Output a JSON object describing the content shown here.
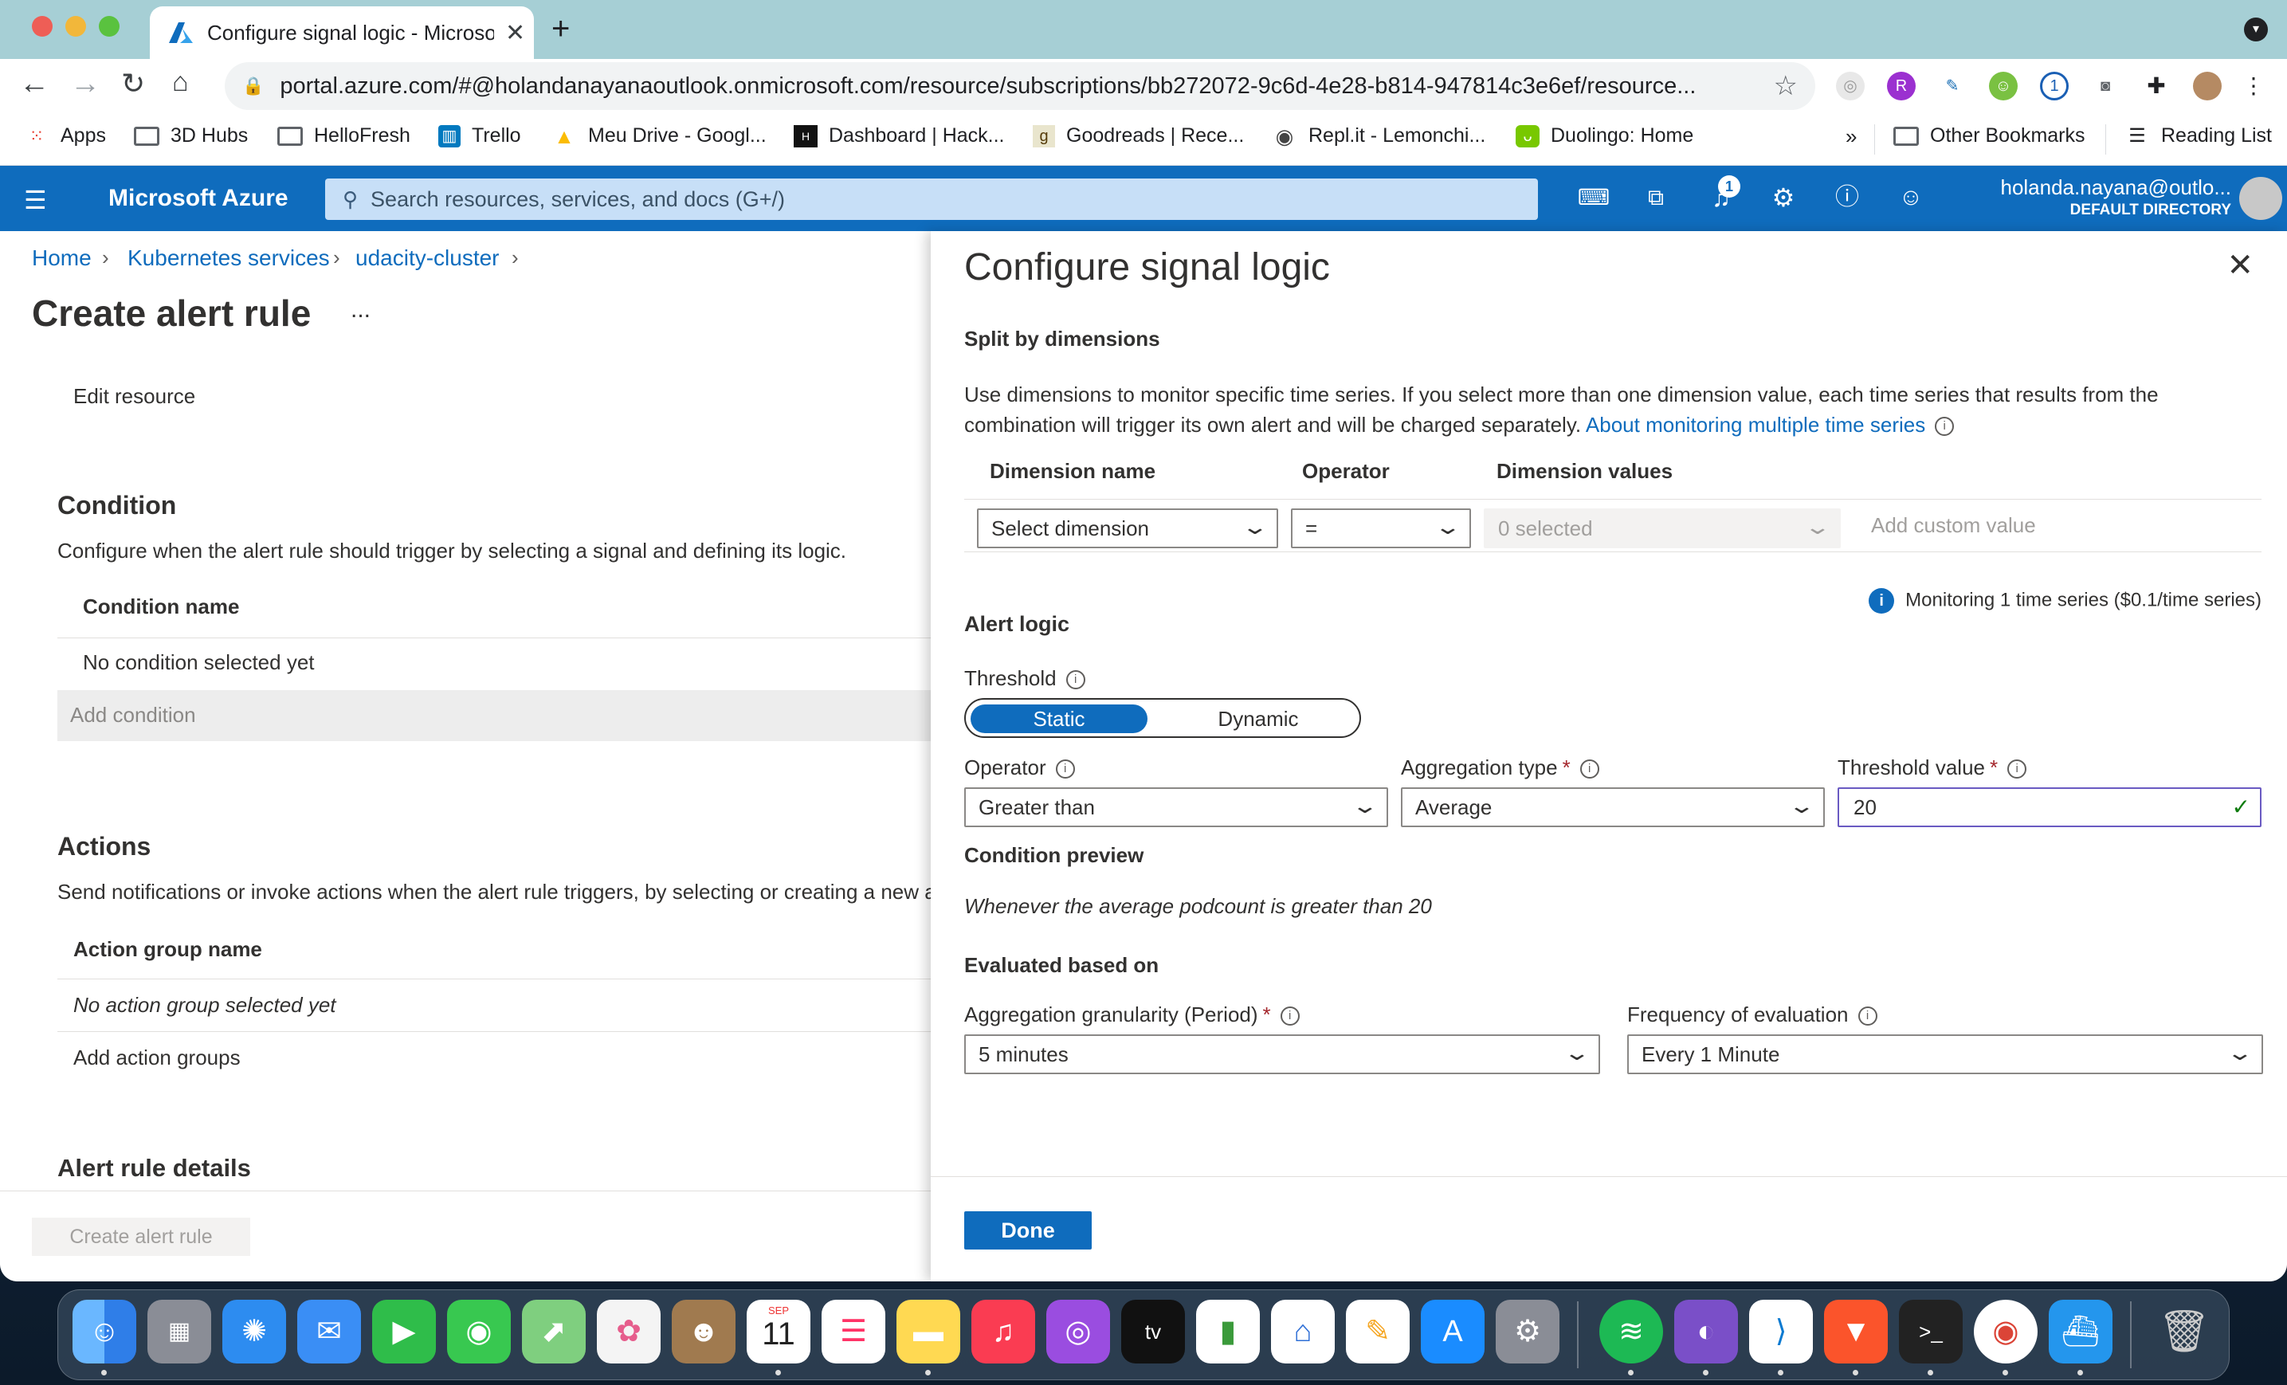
{
  "browser": {
    "tab_title": "Configure signal logic - Microsoft Azure",
    "new_tab": "+",
    "url": "portal.azure.com/#@holandanayanaoutlook.onmicrosoft.com/resource/subscriptions/bb272072-9c6d-4e28-b814-947814c3e6ef/resource...",
    "bookmarks": [
      "Apps",
      "3D Hubs",
      "HelloFresh",
      "Trello",
      "Meu Drive - Googl...",
      "Dashboard | Hack...",
      "Goodreads | Rece...",
      "Repl.it - Lemonchi...",
      "Duolingo: Home"
    ],
    "more": "»",
    "other_bookmarks": "Other Bookmarks",
    "reading_list": "Reading List"
  },
  "azure": {
    "brand": "Microsoft Azure",
    "search_placeholder": "Search resources, services, and docs (G+/)",
    "notif_count": "1",
    "user_email": "holanda.nayana@outlo...",
    "user_directory": "DEFAULT DIRECTORY"
  },
  "left": {
    "breadcrumb": [
      "Home",
      "Kubernetes services",
      "udacity-cluster"
    ],
    "page_title": "Create alert rule",
    "more": "...",
    "edit_resource": "Edit resource",
    "condition_title": "Condition",
    "condition_desc": "Configure when the alert rule should trigger by selecting a signal and defining its logic.",
    "condition_header": "Condition name",
    "condition_empty": "No condition selected yet",
    "add_condition": "Add condition",
    "actions_title": "Actions",
    "actions_desc": "Send notifications or invoke actions when the alert rule triggers, by selecting or creating a new a",
    "action_header": "Action group name",
    "action_empty": "No action group selected yet",
    "add_action": "Add action groups",
    "details_title": "Alert rule details",
    "create_button": "Create alert rule"
  },
  "panel": {
    "title": "Configure signal logic",
    "split_title": "Split by dimensions",
    "split_desc_1": "Use dimensions to monitor specific time series. If you select more than one dimension value, each time series that results from the",
    "split_desc_2": "combination will trigger its own alert and will be charged separately.",
    "split_link": "About monitoring multiple time series",
    "dim_header_name": "Dimension name",
    "dim_header_operator": "Operator",
    "dim_header_values": "Dimension values",
    "dim_select": "Select dimension",
    "dim_operator": "=",
    "dim_values": "0 selected",
    "dim_custom": "Add custom value",
    "monitoring_note": "Monitoring 1 time series ($0.1/time series)",
    "alert_logic": "Alert logic",
    "threshold_label": "Threshold",
    "threshold_static": "Static",
    "threshold_dynamic": "Dynamic",
    "operator_label": "Operator",
    "operator_value": "Greater than",
    "aggregation_label": "Aggregation type",
    "aggregation_value": "Average",
    "threshold_value_label": "Threshold value",
    "threshold_value": "20",
    "condition_preview_label": "Condition preview",
    "condition_preview": "Whenever the average podcount is greater than 20",
    "evaluated_label": "Evaluated based on",
    "granularity_label": "Aggregation granularity (Period)",
    "granularity_value": "5 minutes",
    "frequency_label": "Frequency of evaluation",
    "frequency_value": "Every 1 Minute",
    "done": "Done"
  },
  "dock": {
    "calendar_month": "SEP",
    "calendar_day": "11",
    "tv": "tv"
  }
}
